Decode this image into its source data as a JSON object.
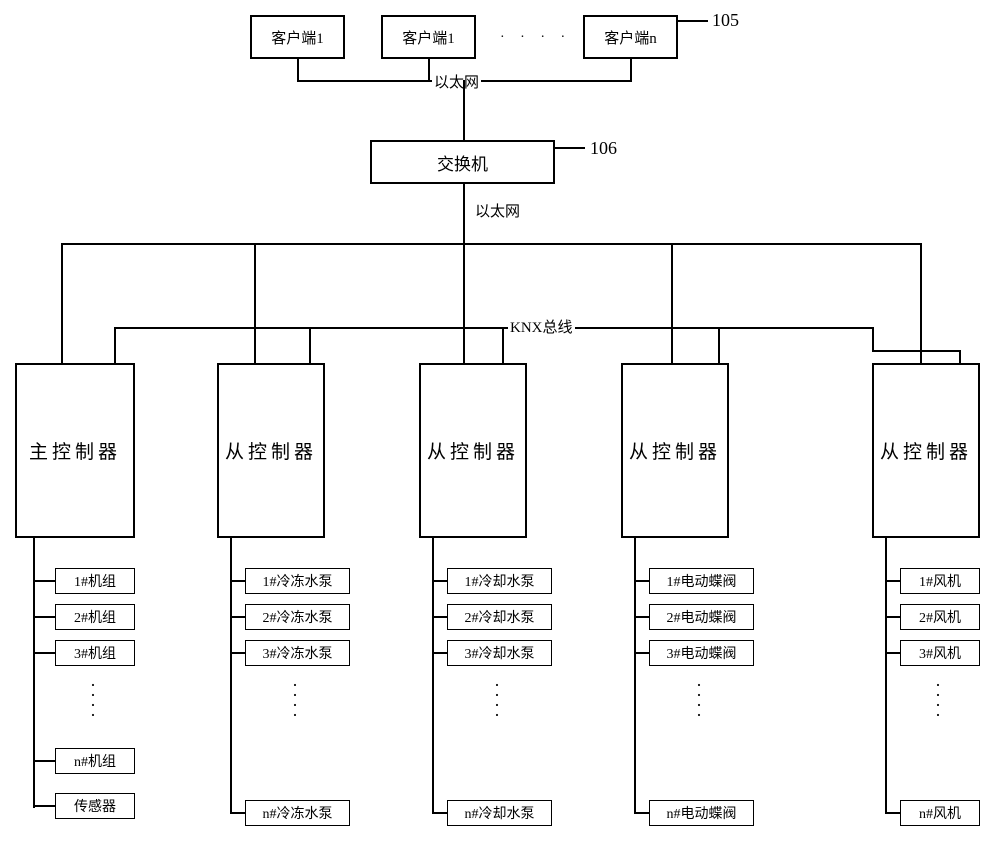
{
  "clients": {
    "c1": "客户端1",
    "c2": "客户端1",
    "cn": "客户端n"
  },
  "net": {
    "ethernet": "以太网",
    "knx": "KNX总线"
  },
  "switch": "交换机",
  "refs": {
    "r105": "105",
    "r106": "106"
  },
  "controllers": {
    "master": "主控制器",
    "slave": "从控制器"
  },
  "devices": {
    "col1": {
      "d1": "1#机组",
      "d2": "2#机组",
      "d3": "3#机组",
      "dn": "n#机组",
      "sensor": "传感器"
    },
    "col2": {
      "d1": "1#冷冻水泵",
      "d2": "2#冷冻水泵",
      "d3": "3#冷冻水泵",
      "dn": "n#冷冻水泵"
    },
    "col3": {
      "d1": "1#冷却水泵",
      "d2": "2#冷却水泵",
      "d3": "3#冷却水泵",
      "dn": "n#冷却水泵"
    },
    "col4": {
      "d1": "1#电动蝶阀",
      "d2": "2#电动蝶阀",
      "d3": "3#电动蝶阀",
      "dn": "n#电动蝶阀"
    },
    "col5": {
      "d1": "1#风机",
      "d2": "2#风机",
      "d3": "3#风机",
      "dn": "n#风机"
    }
  },
  "dots": "· · · ·"
}
